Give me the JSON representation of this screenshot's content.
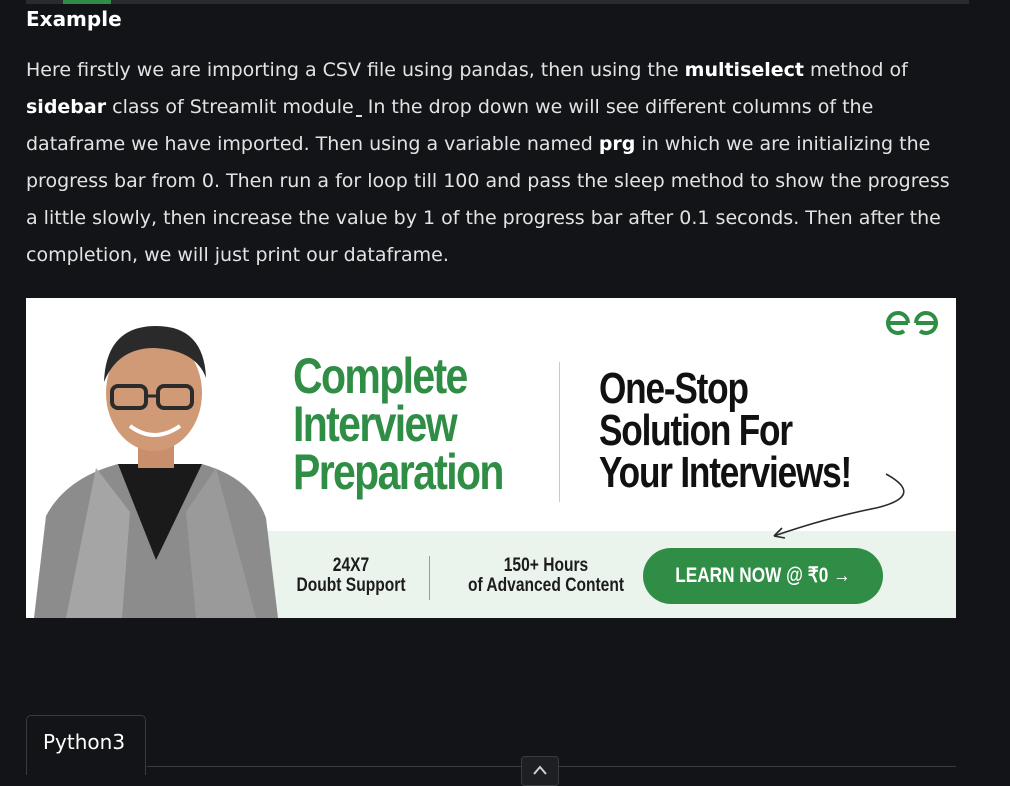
{
  "article": {
    "heading": "Example",
    "para": {
      "t1": "Here firstly we are importing a CSV file using pandas, then using the ",
      "b1": "multiselect",
      "t2": " method of ",
      "b2": "sidebar",
      "t3": " class of Streamlit module",
      "t4": " In the drop down we will see different columns of the dataframe we have imported. Then using a variable named ",
      "b3": "prg",
      "t5": " in which we are initializing the progress bar from 0. Then run a for loop till 100 and pass the sleep method to show the progress a little slowly, then increase the value by 1 of the progress bar after 0.1 seconds. Then after the completion, we will just print our dataframe."
    }
  },
  "banner": {
    "logo_icon": "gfg-logo-icon",
    "headline_lines": [
      "Complete",
      "Interview",
      "Preparation"
    ],
    "tagline_lines": [
      "One-Stop",
      "Solution For",
      "Your Interviews!"
    ],
    "feature1_lines": [
      "24X7",
      "Doubt Support"
    ],
    "feature2_lines": [
      "150+ Hours",
      "of Advanced Content"
    ],
    "cta_label": "LEARN NOW @ ₹0 →",
    "accent_color": "#2f8d46"
  },
  "code_tabs": {
    "active_tab": "Python3",
    "scroll_icon": "chevron-up-icon"
  }
}
